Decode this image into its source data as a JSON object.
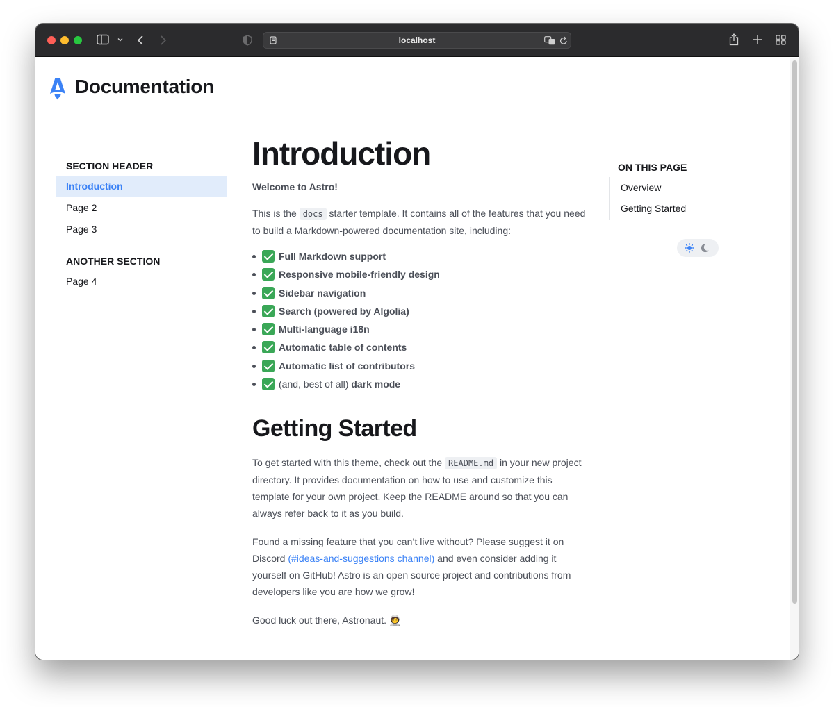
{
  "browser": {
    "url": "localhost"
  },
  "site": {
    "title": "Documentation"
  },
  "sidebar": {
    "sections": [
      {
        "header": "SECTION HEADER",
        "items": [
          "Introduction",
          "Page 2",
          "Page 3"
        ]
      },
      {
        "header": "ANOTHER SECTION",
        "items": [
          "Page 4"
        ]
      }
    ],
    "active_item": "Introduction"
  },
  "main": {
    "title": "Introduction",
    "lead": "Welcome to Astro!",
    "intro_before": "This is the ",
    "intro_code": "docs",
    "intro_after": " starter template. It contains all of the features that you need to build a Markdown-powered documentation site, including:",
    "features": [
      "Full Markdown support",
      "Responsive mobile-friendly design",
      "Sidebar navigation",
      "Search (powered by Algolia)",
      "Multi-language i18n",
      "Automatic table of contents",
      "Automatic list of contributors"
    ],
    "last_feature_prefix": "(and, best of all) ",
    "last_feature_bold": "dark mode",
    "getting_started": {
      "title": "Getting Started",
      "p1_before": "To get started with this theme, check out the ",
      "p1_code": "README.md",
      "p1_after": " in your new project directory. It provides documentation on how to use and customize this template for your own project. Keep the README around so that you can always refer back to it as you build.",
      "p2_before": "Found a missing feature that you can’t live without? Please suggest it on Discord ",
      "p2_link": "(#ideas-and-suggestions channel)",
      "p2_after": " and even consider adding it yourself on GitHub! Astro is an open source project and contributions from developers like you are how we grow!",
      "p3": "Good luck out there, Astronaut. 🧑‍🚀"
    }
  },
  "toc": {
    "title": "ON THIS PAGE",
    "items": [
      "Overview",
      "Getting Started"
    ]
  },
  "colors": {
    "accent": "#3b82f6",
    "active_bg": "#e1ecfb",
    "heading": "#17181c",
    "body_text": "#4b4f58"
  }
}
